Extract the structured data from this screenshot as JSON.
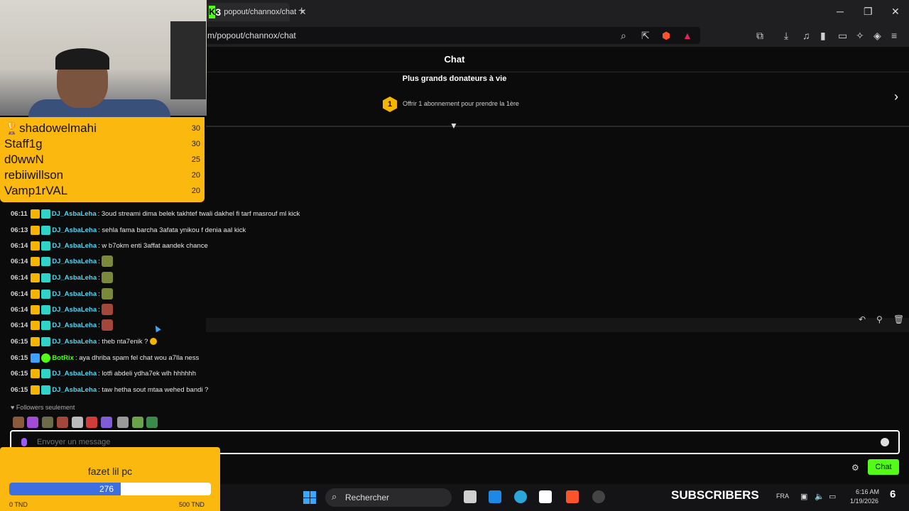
{
  "browser": {
    "tab_title": "popout/channox/chat",
    "tab_badge": "3",
    "url": "m/popout/channox/chat",
    "new_tab": "+",
    "tab_close": "✕",
    "minimize": "─",
    "maximize": "❐",
    "close": "✕"
  },
  "chat": {
    "title": "Chat",
    "donors_title": "Plus grands donateurs à vie",
    "donors_rank": "1",
    "donors_offer": "Offrir 1 abonnement pour prendre la 1ère",
    "messages": [
      {
        "time": "06:11",
        "user": "DJ_AsbaLeha",
        "text": ": 3oud streami dima belek takhtef twali dakhel fi tarf masrouf ml kick"
      },
      {
        "time": "06:13",
        "user": "DJ_AsbaLeha",
        "text": ": sehla fama barcha 3afata ynikou f denia aal kick"
      },
      {
        "time": "06:14",
        "user": "DJ_AsbaLeha",
        "text": ": w b7okm enti 3affat aandek chance"
      },
      {
        "time": "06:14",
        "user": "DJ_AsbaLeha",
        "text": ":"
      },
      {
        "time": "06:14",
        "user": "DJ_AsbaLeha",
        "text": ":"
      },
      {
        "time": "06:14",
        "user": "DJ_AsbaLeha",
        "text": ":"
      },
      {
        "time": "06:14",
        "user": "DJ_AsbaLeha",
        "text": ":"
      },
      {
        "time": "06:14",
        "user": "DJ_AsbaLeha",
        "text": ":"
      },
      {
        "time": "06:15",
        "user": "DJ_AsbaLeha",
        "text": ": theb nta7enik ?"
      },
      {
        "time": "06:15",
        "user": "BotRix",
        "text": ": aya dhriba spam fel chat wou a7lla ness"
      },
      {
        "time": "06:15",
        "user": "DJ_AsbaLeha",
        "text": ": lotfi abdeli ydha7ek wlh hhhhhh"
      },
      {
        "time": "06:15",
        "user": "DJ_AsbaLeha",
        "text": ": taw hetha sout mtaa wehed bandi ?"
      }
    ],
    "followers_only": "♥ Followers seulement",
    "input_placeholder": "Envoyer un message",
    "send_label": "Chat"
  },
  "leaderboard": [
    {
      "name": "shadowelmahi",
      "value": "30",
      "trophy": "🏆"
    },
    {
      "name": "Staff1g",
      "value": "30"
    },
    {
      "name": "d0wwN",
      "value": "25"
    },
    {
      "name": "rebiiwillson",
      "value": "20"
    },
    {
      "name": "Vamp1rVAL",
      "value": "20"
    }
  ],
  "goal": {
    "title": "fazet lil pc",
    "current": "276",
    "progress_fraction": 0.552,
    "min_label": "0 TND",
    "max_label": "500 TND"
  },
  "taskbar": {
    "search_label": "Rechercher",
    "subscribers_label": "SUBSCRIBERS",
    "language": "FRA",
    "time": "6:16 AM",
    "date": "1/19/2026",
    "notification_count": "6"
  },
  "colors": {
    "kick_green": "#53fc18",
    "widget_yellow": "#fbb80f",
    "username_cyan": "#4fd7f2",
    "goal_blue": "#3d6fe0"
  }
}
